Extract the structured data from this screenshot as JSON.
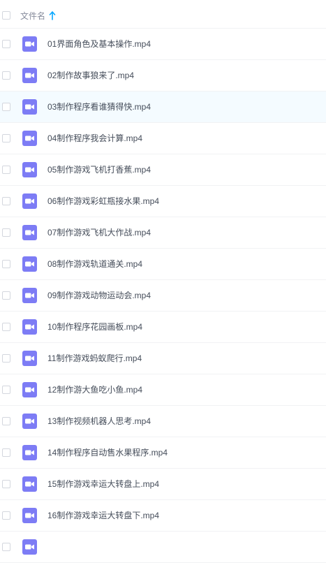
{
  "header": {
    "column_label": "文件名",
    "sort_icon": "arrow-up-icon",
    "accent_color": "#06a7ff"
  },
  "file_icon": {
    "name": "video-file-icon",
    "color": "#7d7cf5"
  },
  "files": [
    {
      "name": "01界面角色及基本操作.mp4",
      "selected": false
    },
    {
      "name": "02制作故事狼来了.mp4",
      "selected": false
    },
    {
      "name": "03制作程序看谁猜得快.mp4",
      "selected": true
    },
    {
      "name": "04制作程序我会计算.mp4",
      "selected": false
    },
    {
      "name": "05制作游戏飞机打香蕉.mp4",
      "selected": false
    },
    {
      "name": "06制作游戏彩虹瓶接水果.mp4",
      "selected": false
    },
    {
      "name": "07制作游戏飞机大作战.mp4",
      "selected": false
    },
    {
      "name": "08制作游戏轨道通关.mp4",
      "selected": false
    },
    {
      "name": "09制作游戏动物运动会.mp4",
      "selected": false
    },
    {
      "name": "10制作程序花园画板.mp4",
      "selected": false
    },
    {
      "name": "11制作游戏蚂蚁爬行.mp4",
      "selected": false
    },
    {
      "name": "12制作游大鱼吃小鱼.mp4",
      "selected": false
    },
    {
      "name": "13制作视频机器人思考.mp4",
      "selected": false
    },
    {
      "name": "14制作程序自动售水果程序.mp4",
      "selected": false
    },
    {
      "name": "15制作游戏幸运大转盘上.mp4",
      "selected": false
    },
    {
      "name": "16制作游戏幸运大转盘下.mp4",
      "selected": false
    },
    {
      "name": "",
      "selected": false
    }
  ]
}
